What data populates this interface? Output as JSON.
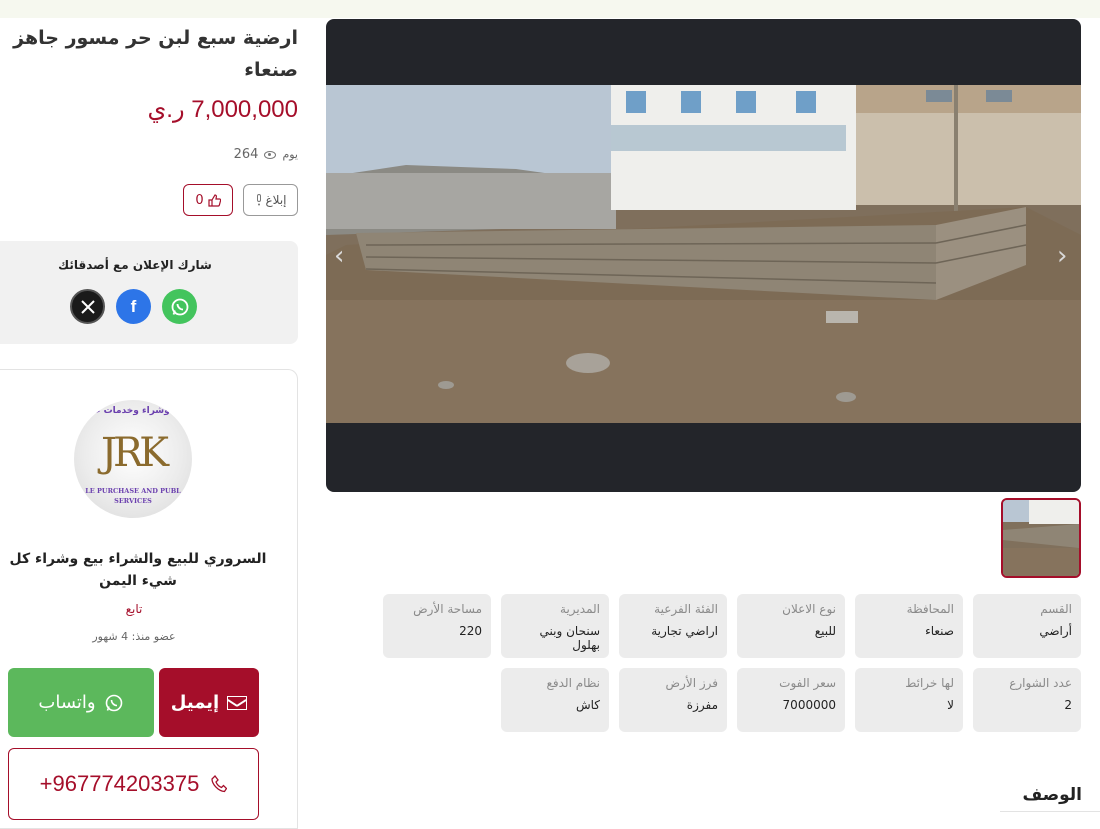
{
  "listing": {
    "title": "ارضية سبع لبن حر مسور جاهز صنعاء",
    "price": "7,000,000 ر.ي",
    "views": "264",
    "views_unit": "يوم",
    "report_label": "إبلاغ",
    "likes": "0"
  },
  "share": {
    "title": "شارك الإعلان مع أصدقائك",
    "icons": [
      "x-icon",
      "facebook-icon",
      "whatsapp-icon"
    ]
  },
  "seller": {
    "logo_text_top": "بيع وشراء وخدمات عامة",
    "logo_monogram": "JRK",
    "logo_text_bottom": "LE PURCHASE AND PUBL SERVICES",
    "name": "السروري للبيع والشراء بيع وشراء كل شيء اليمن",
    "follow_label": "تابع",
    "member_since": "عضو منذ: 4 شهور",
    "whatsapp_label": "واتساب",
    "email_label": "إيميل",
    "phone": "+967774203375"
  },
  "details": [
    {
      "key": "القسم",
      "value": "أراضي"
    },
    {
      "key": "المحافظة",
      "value": "صنعاء"
    },
    {
      "key": "نوع الاعلان",
      "value": "للبيع"
    },
    {
      "key": "الفئة الفرعية",
      "value": "اراضي تجارية"
    },
    {
      "key": "المديرية",
      "value": "سنحان وبني بهلول"
    },
    {
      "key": "مساحة الأرض",
      "value": "220"
    },
    {
      "key": "عدد الشوارع",
      "value": "2"
    },
    {
      "key": "لها خرائط",
      "value": "لا"
    },
    {
      "key": "سعر الفوت",
      "value": "7000000"
    },
    {
      "key": "فرز الأرض",
      "value": "مفرزة"
    },
    {
      "key": "نظام الدفع",
      "value": "كاش"
    }
  ],
  "description_title": "الوصف",
  "colors": {
    "accent": "#a50e2a",
    "whatsapp": "#5cb85c",
    "facebook": "#2d75e8",
    "panel": "#ececec"
  }
}
